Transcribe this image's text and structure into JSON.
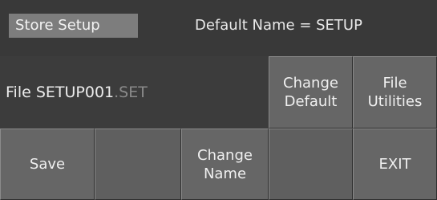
{
  "header": {
    "title": "Store Setup",
    "default_name": "Default Name = SETUP"
  },
  "file": {
    "label": "File SETUP001",
    "extension": ".SET"
  },
  "right_buttons": [
    {
      "label": "Change\nDefault"
    },
    {
      "label": "File\nUtilities"
    }
  ],
  "bottom_buttons": [
    {
      "label": "Save"
    },
    {
      "label": ""
    },
    {
      "label": "Change\nName"
    },
    {
      "label": ""
    },
    {
      "label": "EXIT"
    }
  ]
}
